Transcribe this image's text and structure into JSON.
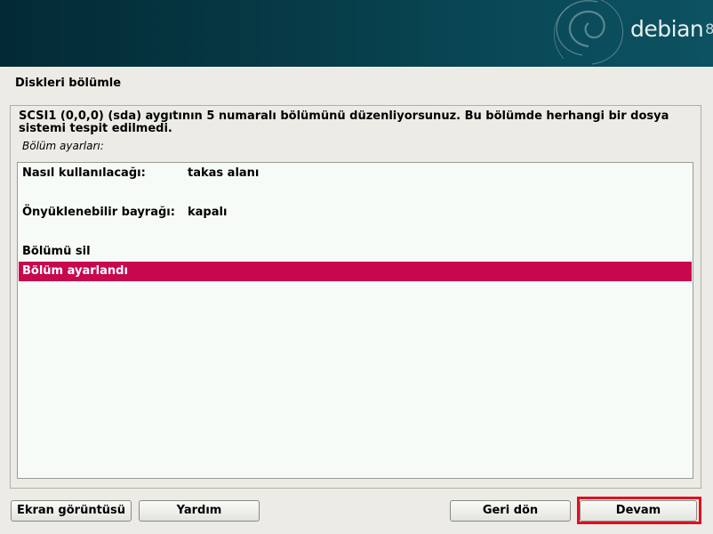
{
  "header": {
    "brand": "debian",
    "version": "8"
  },
  "page": {
    "title": "Diskleri bölümle"
  },
  "content": {
    "description": "SCSI1 (0,0,0) (sda) aygıtının 5 numaralı bölümünü düzenliyorsunuz. Bu bölümde herhangi bir dosya sistemi tespit edilmedi.",
    "sublabel": "Bölüm ayarları:",
    "settings": [
      {
        "label": "Nasıl kullanılacağı:",
        "value": "takas alanı"
      },
      {
        "label": "Önyüklenebilir bayrağı:",
        "value": "kapalı"
      }
    ],
    "actions": [
      {
        "label": "Bölümü sil",
        "selected": false
      },
      {
        "label": "Bölüm ayarlandı",
        "selected": true
      }
    ]
  },
  "buttons": {
    "screenshot": "Ekran görüntüsü",
    "help": "Yardım",
    "back": "Geri dön",
    "continue": "Devam"
  },
  "colors": {
    "selection": "#c7084f",
    "banner": "#063a46",
    "focus": "#e01020"
  }
}
